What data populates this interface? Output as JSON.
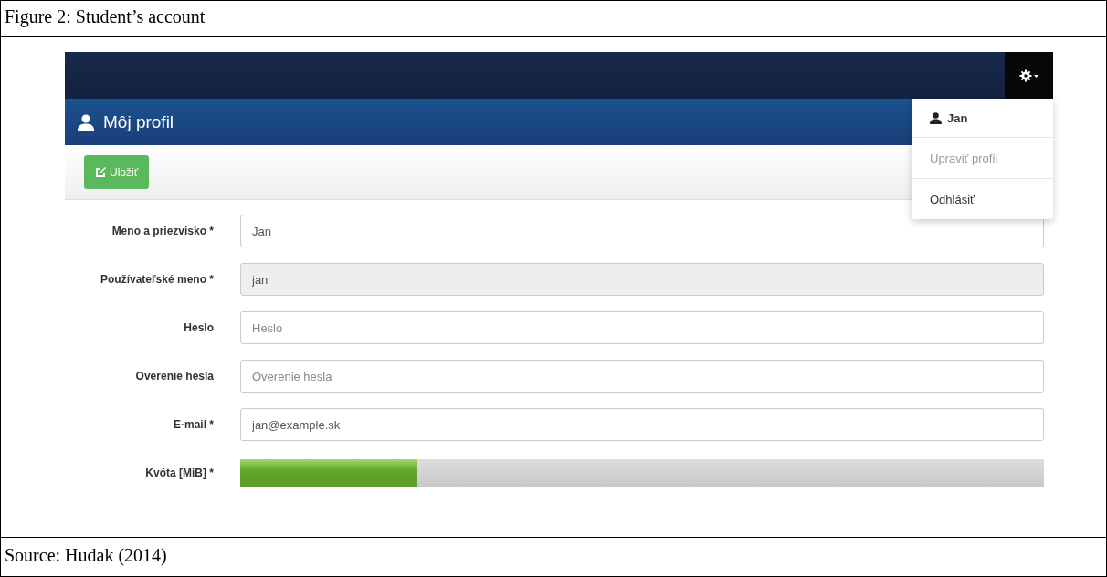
{
  "figure": {
    "caption": "Figure 2: Student’s account",
    "source": "Source: Hudak (2014)"
  },
  "page_title": "Môj profil",
  "save_button": "Uložiť",
  "user_menu": {
    "expanded": true,
    "items": [
      {
        "kind": "user",
        "label": "Jan"
      },
      {
        "kind": "link",
        "label": "Upraviť profil",
        "disabled": true
      },
      {
        "kind": "link",
        "label": "Odhlásiť",
        "disabled": false
      }
    ]
  },
  "fields": [
    {
      "kind": "text",
      "label": "Meno a priezvisko *",
      "value": "Jan",
      "disabled": false
    },
    {
      "kind": "text",
      "label": "Používateľské meno *",
      "value": "jan",
      "disabled": true
    },
    {
      "kind": "text",
      "label": "Heslo",
      "placeholder": "Heslo",
      "disabled": false
    },
    {
      "kind": "text",
      "label": "Overenie hesla",
      "placeholder": "Overenie hesla",
      "disabled": false
    },
    {
      "kind": "text",
      "label": "E-mail *",
      "value": "jan@example.sk",
      "disabled": false
    },
    {
      "kind": "progress",
      "label": "Kvóta [MiB] *",
      "level": 0.22
    }
  ]
}
